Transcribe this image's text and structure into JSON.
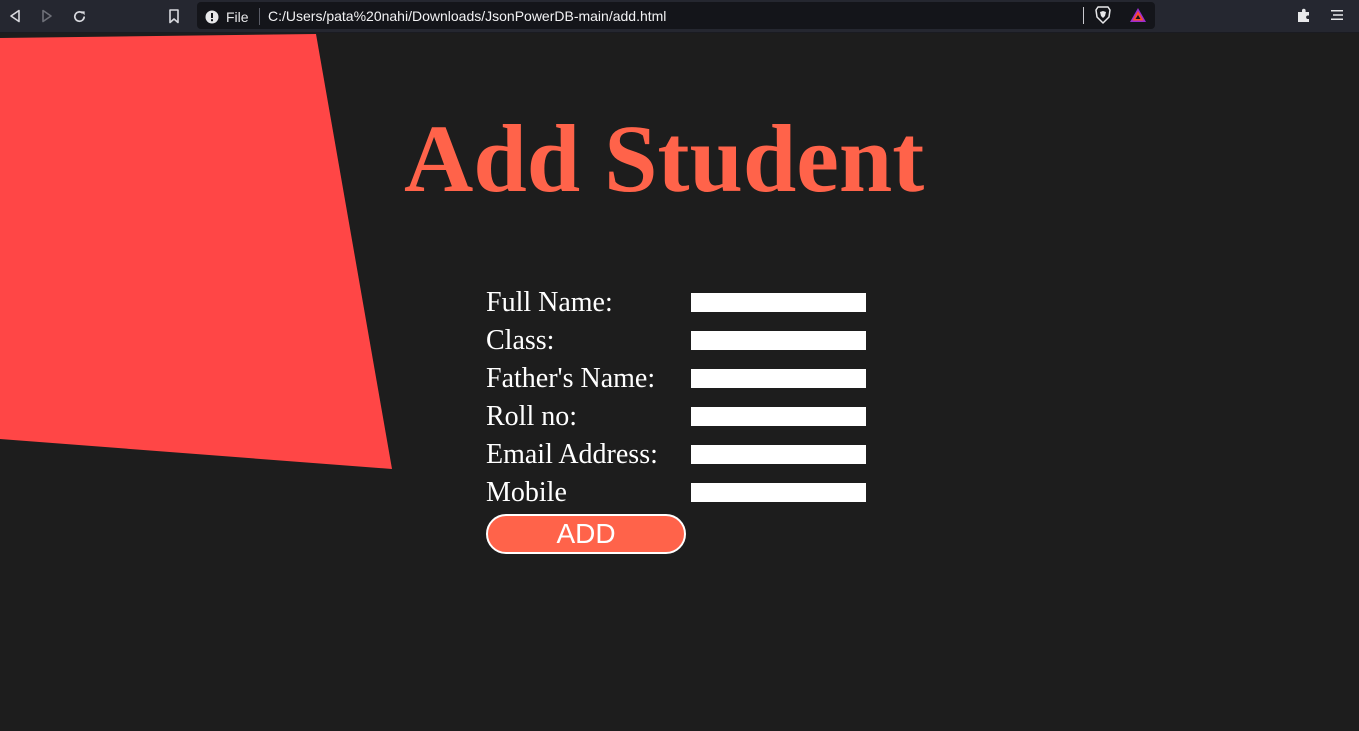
{
  "browser": {
    "site_info_label": "File",
    "url": "C:/Users/pata%20nahi/Downloads/JsonPowerDB-main/add.html",
    "icons": [
      "back-icon",
      "forward-icon",
      "reload-icon",
      "bookmark-icon",
      "info-icon",
      "brave-shields-icon",
      "brave-rewards-icon",
      "extensions-icon",
      "menu-icon"
    ]
  },
  "page": {
    "title": "Add Student",
    "accent_color": "#ff634a",
    "shape_color": "#ff4646",
    "background_color": "#1d1d1d",
    "fields": [
      {
        "label": "Full Name:",
        "value": ""
      },
      {
        "label": "Class:",
        "value": ""
      },
      {
        "label": "Father's Name:",
        "value": ""
      },
      {
        "label": "Roll no:",
        "value": ""
      },
      {
        "label": "Email Address:",
        "value": ""
      },
      {
        "label": "Mobile",
        "value": ""
      }
    ],
    "add_button_label": "ADD"
  }
}
